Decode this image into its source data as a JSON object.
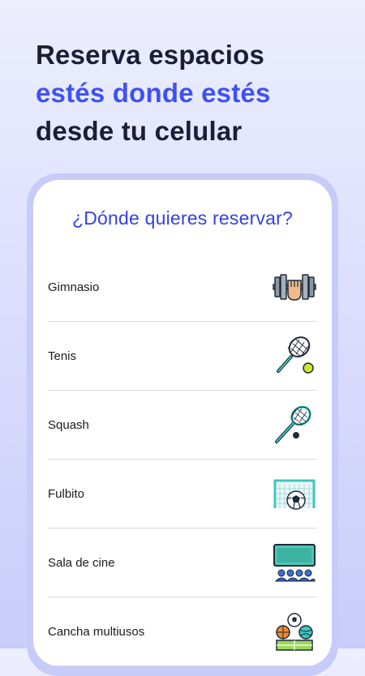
{
  "headline": {
    "line1": "Reserva espacios",
    "line2": "estés donde estés",
    "line3": "desde tu celular"
  },
  "screen": {
    "question": "¿Dónde quieres reservar?",
    "items": [
      {
        "label": "Gimnasio",
        "icon": "dumbbell-fist-icon"
      },
      {
        "label": "Tenis",
        "icon": "tennis-racket-icon"
      },
      {
        "label": "Squash",
        "icon": "squash-racket-icon"
      },
      {
        "label": "Fulbito",
        "icon": "soccer-goal-icon"
      },
      {
        "label": "Sala de cine",
        "icon": "cinema-screen-icon"
      },
      {
        "label": "Cancha multiusos",
        "icon": "multisport-balls-icon"
      }
    ]
  },
  "colors": {
    "accent": "#3f51f3",
    "headline": "#1c1d3a"
  }
}
